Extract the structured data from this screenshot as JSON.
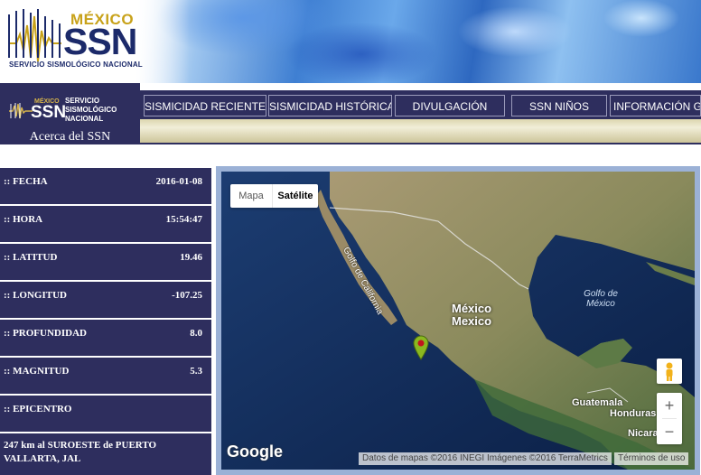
{
  "header": {
    "logo_country": "MÉXICO",
    "logo_acronym": "SSN",
    "logo_subtitle": "SERVICIO SISMOLÓGICO NACIONAL"
  },
  "sidebar_logo": {
    "country": "MÉXICO",
    "acronym": "SSN",
    "subtitle": "SERVICIO SISMOLÓGICO NACIONAL",
    "acerca_label": "Acerca del SSN"
  },
  "nav": {
    "items": [
      {
        "label": "SISMICIDAD RECIENTE"
      },
      {
        "label": "SISMICIDAD HISTÓRICA"
      },
      {
        "label": "DIVULGACIÓN"
      },
      {
        "label": "SSN NIÑOS"
      },
      {
        "label": "INFORMACIÓN GE"
      }
    ]
  },
  "quake": {
    "fecha": {
      "label": ":: FECHA",
      "value": "2016-01-08"
    },
    "hora": {
      "label": ":: HORA",
      "value": "15:54:47"
    },
    "latitud": {
      "label": ":: LATITUD",
      "value": "19.46"
    },
    "longitud": {
      "label": ":: LONGITUD",
      "value": "-107.25"
    },
    "profundidad": {
      "label": ":: PROFUNDIDAD",
      "value": "8.0"
    },
    "magnitud": {
      "label": ":: MAGNITUD",
      "value": "5.3"
    },
    "epicentro": {
      "label": ":: EPICENTRO",
      "value": "247 km al SUROESTE de PUERTO VALLARTA, JAL"
    }
  },
  "map": {
    "type_map_label": "Mapa",
    "type_satellite_label": "Satélite",
    "labels": {
      "gulf_california": "Golfo de California",
      "mexico_1": "México",
      "mexico_2": "Mexico",
      "gulf_mexico": "Golfo de México",
      "guatemala": "Guatemala",
      "honduras": "Honduras",
      "nicaragua": "Nicara"
    },
    "google_logo": "Google",
    "attribution": "Datos de mapas ©2016 INEGI Imágenes ©2016 TerraMetrics",
    "terms": "Términos de uso",
    "zoom_in": "+",
    "zoom_out": "−"
  }
}
